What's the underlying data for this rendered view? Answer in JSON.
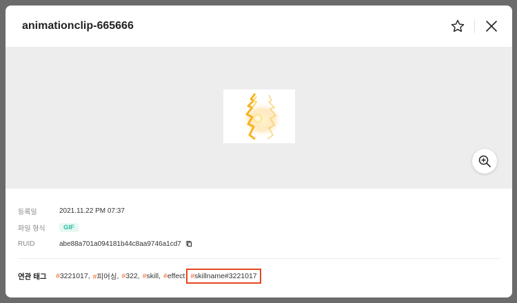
{
  "modal": {
    "title": "animationclip-665666"
  },
  "info": {
    "registered_label": "등록일",
    "registered_value": "2021.11.22 PM 07:37",
    "format_label": "파일 형식",
    "format_value": "GIF",
    "ruid_label": "RUID",
    "ruid_value": "abe88a701a094181b44c8aa9746a1cd7"
  },
  "tags": {
    "label": "연관 태그",
    "hash": "#",
    "items": [
      "3221017",
      "피어싱",
      "322",
      "skill",
      "effect"
    ],
    "highlighted": "skillname#3221017",
    "separator": ","
  },
  "colors": {
    "accent_orange": "#f06a2a",
    "highlight_border": "#e2471e",
    "badge_green": "#2bbfa0"
  },
  "icons": {
    "favorite": "star-icon",
    "close": "close-icon",
    "zoom": "zoom-in-icon",
    "copy": "copy-icon"
  }
}
